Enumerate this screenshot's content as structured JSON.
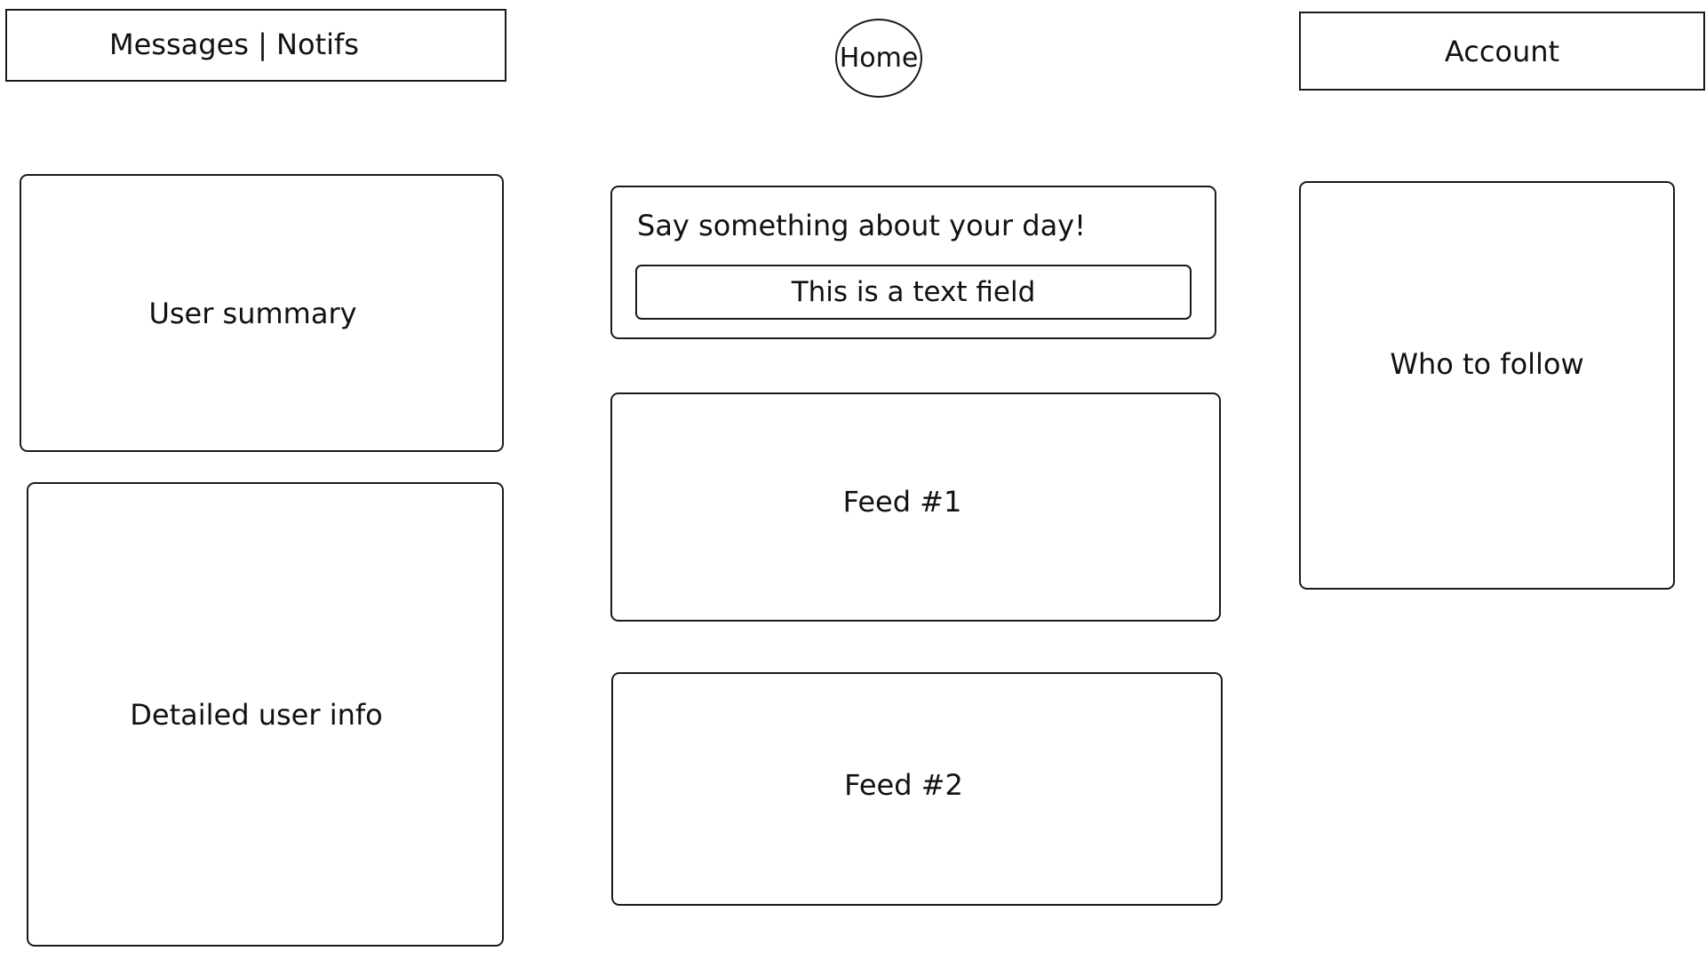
{
  "header": {
    "messages_notifs_label": "Messages | Notifs",
    "home_label": "Home",
    "account_label": "Account"
  },
  "left_column": {
    "user_summary_label": "User summary",
    "detailed_user_info_label": "Detailed user info"
  },
  "compose": {
    "prompt": "Say something about your day!",
    "input_placeholder": "This is a text field"
  },
  "feed": {
    "items": [
      {
        "label": "Feed #1"
      },
      {
        "label": "Feed #2"
      }
    ]
  },
  "right_column": {
    "who_to_follow_label": "Who to follow"
  }
}
